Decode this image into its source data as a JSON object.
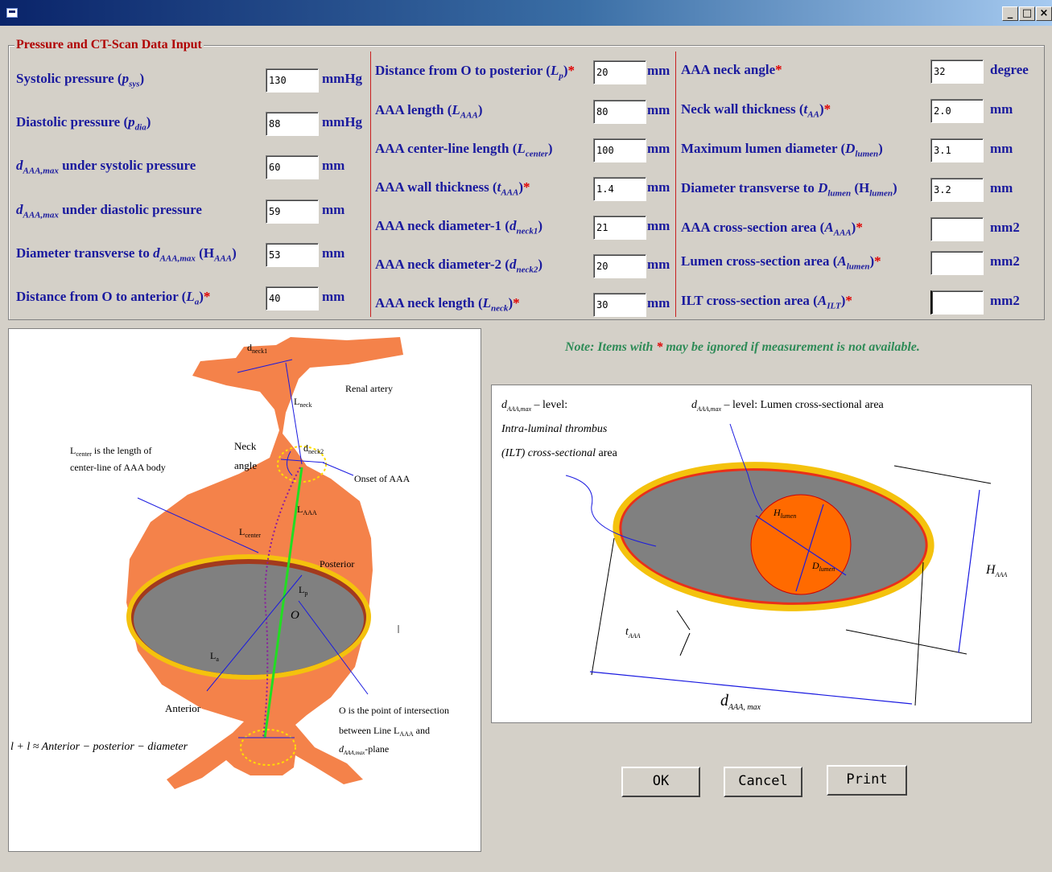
{
  "window": {
    "minimize": "_",
    "restore": "□",
    "close": "×"
  },
  "form_title": "Pressure and CT-Scan Data Input",
  "col1": [
    {
      "text": "Systolic pressure (",
      "sym": "p",
      "sub": "sys",
      "tail": ")",
      "star": "",
      "value": "130",
      "unit": "mmHg"
    },
    {
      "text": "Diastolic pressure (",
      "sym": "p",
      "sub": "dia",
      "tail": ")",
      "star": "",
      "value": "88",
      "unit": "mmHg"
    },
    {
      "text": "",
      "sym": "d",
      "sub": "AAA,max",
      "tail": " under systolic pressure",
      "star": "",
      "value": "60",
      "unit": "mm"
    },
    {
      "text": "",
      "sym": "d",
      "sub": "AAA,max",
      "tail": " under diastolic pressure",
      "star": "",
      "value": "59",
      "unit": "mm"
    },
    {
      "text": "Diameter transverse to ",
      "sym": "d",
      "sub": "AAA,max",
      "tail": " (H",
      "sub2": "AAA",
      "tail2": ")",
      "star": "",
      "value": "53",
      "unit": "mm"
    },
    {
      "text": "Distance from O to anterior (",
      "sym": "L",
      "sub": "a",
      "tail": ")",
      "star": "*",
      "value": "40",
      "unit": "mm"
    }
  ],
  "col2": [
    {
      "text": "Distance from O to posterior (",
      "sym": "L",
      "sub": "p",
      "tail": ")",
      "star": "*",
      "value": "20",
      "unit": "mm"
    },
    {
      "text": "AAA length (",
      "sym": "L",
      "sub": "AAA",
      "tail": ")",
      "star": "",
      "value": "80",
      "unit": "mm"
    },
    {
      "text": "AAA center-line length (",
      "sym": "L",
      "sub": "center",
      "tail": ")",
      "star": "",
      "value": "100",
      "unit": "mm"
    },
    {
      "text": "AAA wall thickness (",
      "sym": "t",
      "sub": "AAA",
      "tail": ")",
      "star": "*",
      "value": "1.4",
      "unit": "mm"
    },
    {
      "text": "AAA neck diameter-1 (",
      "sym": "d",
      "sub": "neck1",
      "tail": ")",
      "star": "",
      "value": "21",
      "unit": "mm"
    },
    {
      "text": "AAA neck diameter-2 (",
      "sym": "d",
      "sub": "neck2",
      "tail": ")",
      "star": "",
      "value": "20",
      "unit": "mm"
    },
    {
      "text": "AAA neck length (",
      "sym": "L",
      "sub": "neck",
      "tail": ")",
      "star": "*",
      "value": "30",
      "unit": "mm"
    }
  ],
  "col3": [
    {
      "text": "AAA neck angle",
      "sym": "",
      "sub": "",
      "tail": "",
      "star": "*",
      "value": "32",
      "unit": "degree"
    },
    {
      "text": "Neck wall thickness (",
      "sym": "t",
      "sub": "AA",
      "tail": ")",
      "star": "*",
      "value": "2.0",
      "unit": "mm"
    },
    {
      "text": "Maximum lumen diameter (",
      "sym": "D",
      "sub": "lumen",
      "tail": ")",
      "star": "",
      "value": "3.1",
      "unit": "mm"
    },
    {
      "text": "Diameter transverse to ",
      "sym": "D",
      "sub": "lumen",
      "tail": " (H",
      "sub2": "lumen",
      "tail2": ")",
      "star": "",
      "value": "3.2",
      "unit": "mm"
    },
    {
      "text": "AAA cross-section area (",
      "sym": "A",
      "sub": "AAA",
      "tail": ")",
      "star": "*",
      "value": "",
      "unit": "mm2"
    },
    {
      "text": "Lumen cross-section area (",
      "sym": "A",
      "sub": "lumen",
      "tail": ")",
      "star": "*",
      "value": "",
      "unit": "mm2"
    },
    {
      "text": "ILT cross-section area (",
      "sym": "A",
      "sub": "ILT",
      "tail": ")",
      "star": "*",
      "value": "",
      "unit": "mm2"
    }
  ],
  "note": {
    "pre": "Note: Items with ",
    "star": "*",
    "post": " may be ignored if measurement is not available."
  },
  "left_diagram": {
    "d_neck1": "d",
    "d_neck1_sub": "neck1",
    "renal_artery": "Renal artery",
    "l_neck": "L",
    "l_neck_sub": "neck",
    "neck_angle_1": "Neck",
    "neck_angle_2": "angle",
    "d_neck2": "d",
    "d_neck2_sub": "neck2",
    "onset": "Onset of AAA",
    "center_desc_1a": "L",
    "center_desc_1a_sub": "center",
    "center_desc_1b": " is the length of",
    "center_desc_2": "center-line of AAA body",
    "l_aaa": "L",
    "l_aaa_sub": "AAA",
    "l_center": "L",
    "l_center_sub": "center",
    "posterior": "Posterior",
    "l_p": "L",
    "l_p_sub": "p",
    "o": "O",
    "l_a": "L",
    "l_a_sub": "a",
    "anterior": "Anterior",
    "o_desc_1": "O is the point of intersection",
    "o_desc_2a": "between Line L",
    "o_desc_2_sub": "AAA",
    "o_desc_2b": " and",
    "o_desc_3a": "d",
    "o_desc_3_sub": "AAA,max",
    "o_desc_3b": "-plane",
    "formula": "l + l ≈ Anterior − posterior − diameter"
  },
  "right_diagram": {
    "ilt_1a": "d",
    "ilt_1_sub": "AAA,max",
    "ilt_1b": " – level:",
    "ilt_2": "Intra-luminal thrombus",
    "ilt_3a": "(ILT) cross-sectional",
    "ilt_3b": " area",
    "lumen_a": "d",
    "lumen_sub": "AAA,max",
    "lumen_b": " – level: Lumen cross-sectional area",
    "h_lumen": "H",
    "h_lumen_sub": "lumen",
    "d_lumen": "D",
    "d_lumen_sub": "lumen",
    "h_aaa": "H",
    "h_aaa_sub": "AAA",
    "t_aaa": "t",
    "t_aaa_sub": "AAA",
    "d_aaa": "d",
    "d_aaa_sub": "AAA, max"
  },
  "buttons": {
    "ok": "OK",
    "cancel": "Cancel",
    "print": "Print"
  },
  "colors": {
    "label": "#1a1a9e",
    "star": "#e00000",
    "note": "#2e8b57",
    "tissue": "#f4824a",
    "lumen_gray": "#808080",
    "wall": "#f4c20d"
  }
}
